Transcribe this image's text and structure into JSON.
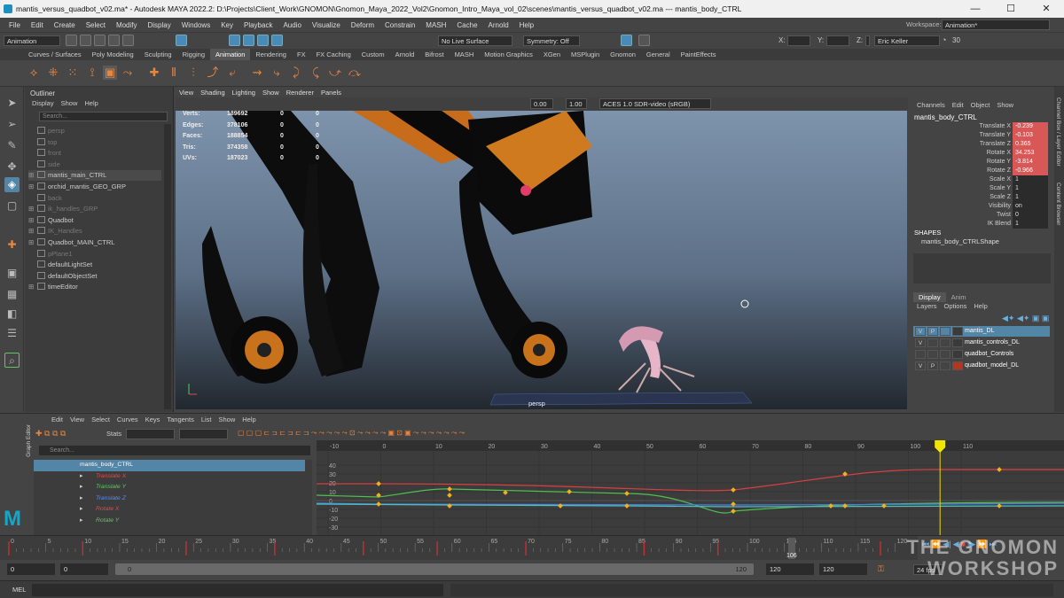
{
  "window": {
    "title": "mantis_versus_quadbot_v02.ma* - Autodesk MAYA 2022.2: D:\\Projects\\Client_Work\\GNOMON\\Gnomon_Maya_2022_Vol2\\Gnomon_Intro_Maya_vol_02\\scenes\\mantis_versus_quadbot_v02.ma --- mantis_body_CTRL",
    "minimize": "—",
    "maximize": "☐",
    "close": "✕"
  },
  "menu": [
    "File",
    "Edit",
    "Create",
    "Select",
    "Modify",
    "Display",
    "Windows",
    "Key",
    "Playback",
    "Audio",
    "Visualize",
    "Deform",
    "Constrain",
    "MASH",
    "Cache",
    "Arnold",
    "Help"
  ],
  "status_line": {
    "menu_set": "Animation",
    "live_surface": "No Live Surface",
    "symmetry": "Symmetry: Off",
    "x_label": "X:",
    "y_label": "Y:",
    "z_label": "Z:",
    "user": "Eric Keller",
    "timer": "30",
    "workspace_label": "Workspace:",
    "workspace": "Animation*"
  },
  "shelf_tabs": [
    "Curves / Surfaces",
    "Poly Modeling",
    "Sculpting",
    "Rigging",
    "Animation",
    "Rendering",
    "FX",
    "FX Caching",
    "Custom",
    "Arnold",
    "Bifrost",
    "MASH",
    "Motion Graphics",
    "XGen",
    "MSPlugin",
    "Gnomon",
    "General",
    "PaintEffects"
  ],
  "shelf_active": "Animation",
  "outliner": {
    "title": "Outliner",
    "menu": [
      "Display",
      "Show",
      "Help"
    ],
    "search_placeholder": "Search...",
    "items": [
      {
        "label": "persp",
        "dim": true,
        "expand": ""
      },
      {
        "label": "top",
        "dim": true,
        "expand": ""
      },
      {
        "label": "front",
        "dim": true,
        "expand": ""
      },
      {
        "label": "side",
        "dim": true,
        "expand": ""
      },
      {
        "label": "mantis_main_CTRL",
        "dim": false,
        "expand": "⊞"
      },
      {
        "label": "orchid_mantis_GEO_GRP",
        "dim": false,
        "expand": "⊞"
      },
      {
        "label": "back",
        "dim": true,
        "expand": ""
      },
      {
        "label": "ik_handles_GRP",
        "dim": true,
        "expand": "⊞"
      },
      {
        "label": "Quadbot",
        "dim": false,
        "expand": "⊞"
      },
      {
        "label": "IK_Handles",
        "dim": true,
        "expand": "⊞"
      },
      {
        "label": "Quadbot_MAIN_CTRL",
        "dim": false,
        "expand": "⊞"
      },
      {
        "label": "pPlane1",
        "dim": true,
        "expand": ""
      },
      {
        "label": "defaultLightSet",
        "dim": false,
        "expand": ""
      },
      {
        "label": "defaultObjectSet",
        "dim": false,
        "expand": ""
      },
      {
        "label": "timeEditor",
        "dim": false,
        "expand": "⊞"
      }
    ]
  },
  "viewport": {
    "menu": [
      "View",
      "Shading",
      "Lighting",
      "Show",
      "Renderer",
      "Panels"
    ],
    "exposure": "0.00",
    "gamma": "1.00",
    "color_space": "ACES 1.0 SDR-video (sRGB)",
    "camera": "persp",
    "hud": [
      {
        "label": "Verts:",
        "a": "189692",
        "b": "0",
        "c": "0"
      },
      {
        "label": "Edges:",
        "a": "378106",
        "b": "0",
        "c": "0"
      },
      {
        "label": "Faces:",
        "a": "188854",
        "b": "0",
        "c": "0"
      },
      {
        "label": "Tris:",
        "a": "374358",
        "b": "0",
        "c": "0"
      },
      {
        "label": "UVs:",
        "a": "187023",
        "b": "0",
        "c": "0"
      }
    ]
  },
  "channel_box": {
    "menu": [
      "Channels",
      "Edit",
      "Object",
      "Show"
    ],
    "object": "mantis_body_CTRL",
    "channels": [
      {
        "name": "Translate X",
        "value": "-0.239",
        "keyed": true
      },
      {
        "name": "Translate Y",
        "value": "-0.103",
        "keyed": true
      },
      {
        "name": "Translate Z",
        "value": "0.365",
        "keyed": true
      },
      {
        "name": "Rotate X",
        "value": "34.253",
        "keyed": true
      },
      {
        "name": "Rotate Y",
        "value": "-3.814",
        "keyed": true
      },
      {
        "name": "Rotate Z",
        "value": "-0.966",
        "keyed": true
      },
      {
        "name": "Scale X",
        "value": "1",
        "keyed": false
      },
      {
        "name": "Scale Y",
        "value": "1",
        "keyed": false
      },
      {
        "name": "Scale Z",
        "value": "1",
        "keyed": false
      },
      {
        "name": "Visibility",
        "value": "on",
        "keyed": false
      },
      {
        "name": "Twist",
        "value": "0",
        "keyed": false
      },
      {
        "name": "IK Blend",
        "value": "1",
        "keyed": false
      }
    ],
    "shapes_header": "SHAPES",
    "shape": "mantis_body_CTRLShape",
    "layer_tabs": [
      "Display",
      "Anim"
    ],
    "layer_menu": [
      "Layers",
      "Options",
      "Help"
    ],
    "layers": [
      {
        "v": "V",
        "p": "P",
        "name": "mantis_DL",
        "color": "#3a3a3a",
        "selected": true
      },
      {
        "v": "V",
        "p": "",
        "name": "mantis_controls_DL",
        "color": "#3a3a3a",
        "selected": false
      },
      {
        "v": "",
        "p": "",
        "name": "quadbot_Controls",
        "color": "#3a3a3a",
        "selected": false
      },
      {
        "v": "V",
        "p": "P",
        "name": "quadbot_model_DL",
        "color": "#b3361e",
        "selected": false
      }
    ],
    "side_tabs": [
      "Channel Box / Layer Editor",
      "Content Browser"
    ]
  },
  "graph_editor": {
    "side_label": "Graph Editor",
    "menu": [
      "Edit",
      "View",
      "Select",
      "Curves",
      "Keys",
      "Tangents",
      "List",
      "Show",
      "Help"
    ],
    "stats_label": "Stats",
    "search_placeholder": "Search...",
    "curves": [
      {
        "label": "mantis_body_CTRL",
        "color": "#ffffff",
        "selected": true
      },
      {
        "label": "Translate X",
        "color": "#e04848",
        "selected": false
      },
      {
        "label": "Translate Y",
        "color": "#5ec85e",
        "selected": false
      },
      {
        "label": "Translate Z",
        "color": "#5c8ce8",
        "selected": false
      },
      {
        "label": "Rotate X",
        "color": "#e04848",
        "selected": false
      },
      {
        "label": "Rotate Y",
        "color": "#5ec85e",
        "selected": false
      }
    ],
    "frame_ticks": [
      "-10",
      "0",
      "10",
      "20",
      "30",
      "40",
      "50",
      "60",
      "70",
      "80",
      "90",
      "100",
      "110"
    ],
    "value_ticks": [
      "40",
      "30",
      "20",
      "10",
      "0",
      "-10",
      "-20",
      "-30"
    ],
    "current_frame": "106"
  },
  "timeline": {
    "ticks": [
      "0",
      "5",
      "10",
      "15",
      "20",
      "25",
      "30",
      "35",
      "40",
      "45",
      "50",
      "55",
      "60",
      "65",
      "70",
      "75",
      "80",
      "85",
      "90",
      "95",
      "100",
      "105",
      "110",
      "115",
      "120"
    ],
    "current_frame": "106"
  },
  "range_slider": {
    "start": "0",
    "anim_start": "0",
    "range_start": "0",
    "range_end": "120",
    "anim_end": "120",
    "end": "120",
    "fps": "24 fps"
  },
  "command_line": {
    "label": "MEL"
  },
  "watermark": {
    "line1": "THE GNOMON",
    "line2": "WORKSHOP"
  }
}
